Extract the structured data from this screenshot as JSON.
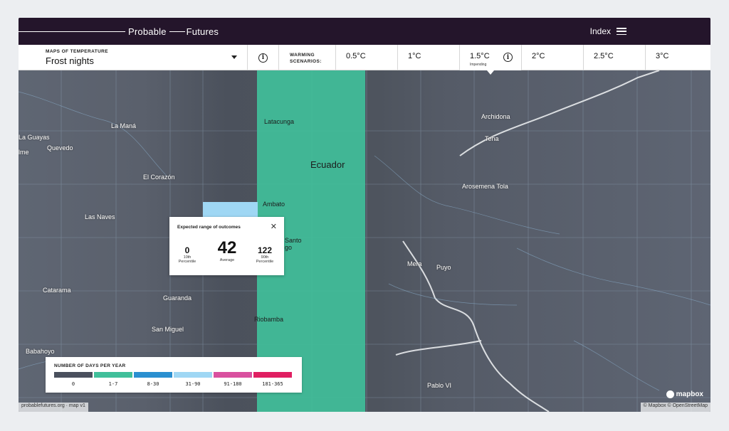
{
  "brand": {
    "word1": "Probable",
    "word2": "Futures"
  },
  "header": {
    "index_label": "Index"
  },
  "map_select": {
    "category": "MAPS OF TEMPERATURE",
    "title": "Frost nights"
  },
  "warming": {
    "label_line1": "WARMING",
    "label_line2": "SCENARIOS:",
    "scenarios": [
      "0.5°C",
      "1°C",
      "1.5°C",
      "2°C",
      "2.5°C",
      "3°C"
    ],
    "active_index": 2,
    "active_sub": "Impending"
  },
  "map_labels": [
    "Latacunga",
    "Ecuador",
    "Ambato",
    "Riobamba",
    "La Maná",
    "Quevedo",
    "La Guayas",
    "El Corazón",
    "Las Naves",
    "Guaranda",
    "Catarama",
    "San Miguel",
    "Babahoyo",
    "Archidona",
    "Tena",
    "Arosemena Tola",
    "Mera",
    "Puyo",
    "Pablo VI",
    "Santo",
    "go",
    "lme"
  ],
  "popup": {
    "title": "Expected range of outcomes",
    "low_value": "0",
    "low_label1": "10th",
    "low_label2": "Percentile",
    "avg_value": "42",
    "avg_label": "Average",
    "high_value": "122",
    "high_label1": "90th",
    "high_label2": "Percentile"
  },
  "legend": {
    "title": "NUMBER OF DAYS PER YEAR",
    "bins": [
      {
        "label": "0",
        "color": "#4a505d"
      },
      {
        "label": "1-7",
        "color": "#40bf9a"
      },
      {
        "label": "8-30",
        "color": "#2a8fd0"
      },
      {
        "label": "31-90",
        "color": "#9fd7f4"
      },
      {
        "label": "91-180",
        "color": "#d9519f"
      },
      {
        "label": "181-365",
        "color": "#e01f62"
      }
    ]
  },
  "attribution": {
    "left": "probablefutures.org · map v1",
    "right": "© Mapbox © OpenStreetMap",
    "logo": "mapbox"
  },
  "colors": {
    "header_bg": "#24152b",
    "map_bg": "#5b6270",
    "band": "#40bf9a",
    "cell": "#9fd7f4"
  }
}
